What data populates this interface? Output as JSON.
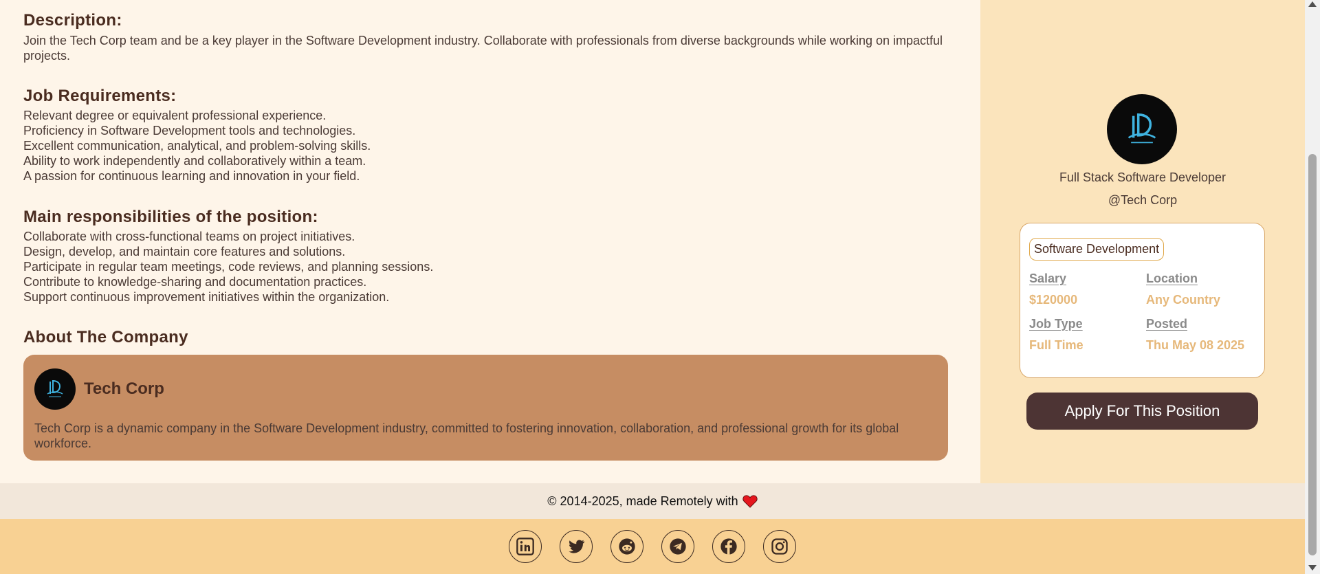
{
  "description": {
    "heading": "Description:",
    "text": "Join the Tech Corp team and be a key player in the Software Development industry. Collaborate with professionals from diverse backgrounds while working on impactful projects."
  },
  "requirements": {
    "heading": "Job Requirements:",
    "items": [
      "Relevant degree or equivalent professional experience.",
      "Proficiency in Software Development tools and technologies.",
      "Excellent communication, analytical, and problem-solving skills.",
      "Ability to work independently and collaboratively within a team.",
      "A passion for continuous learning and innovation in your field."
    ]
  },
  "responsibilities": {
    "heading": "Main responsibilities of the position:",
    "items": [
      "Collaborate with cross-functional teams on project initiatives.",
      "Design, develop, and maintain core features and solutions.",
      "Participate in regular team meetings, code reviews, and planning sessions.",
      "Contribute to knowledge-sharing and documentation practices.",
      "Support continuous improvement initiatives within the organization."
    ]
  },
  "about": {
    "heading": "About The Company",
    "company_name": "Tech Corp",
    "company_desc": "Tech Corp is a dynamic company in the Software Development industry, committed to fostering innovation, collaboration, and professional growth for its global workforce."
  },
  "sidebar": {
    "job_title": "Full Stack Software Developer",
    "company_handle": "@Tech Corp",
    "category_tag": "Software Development",
    "salary_label": "Salary",
    "salary_value": "$120000",
    "location_label": "Location",
    "location_value": "Any Country",
    "jobtype_label": "Job Type",
    "jobtype_value": "Full Time",
    "posted_label": "Posted",
    "posted_value": "Thu May 08 2025",
    "apply_label": "Apply For This Position"
  },
  "footer": {
    "copyright": "© 2014-2025, made Remotely with",
    "socials": [
      "linkedin-icon",
      "twitter-icon",
      "reddit-icon",
      "telegram-icon",
      "facebook-icon",
      "instagram-icon"
    ]
  },
  "colors": {
    "main_bg": "#fef5e9",
    "sidebar_bg": "#fbe4bc",
    "card_bg": "#c68d63",
    "button_bg": "#4d3434",
    "footer_bg": "#f8d193",
    "value_color": "#e6b87a"
  }
}
